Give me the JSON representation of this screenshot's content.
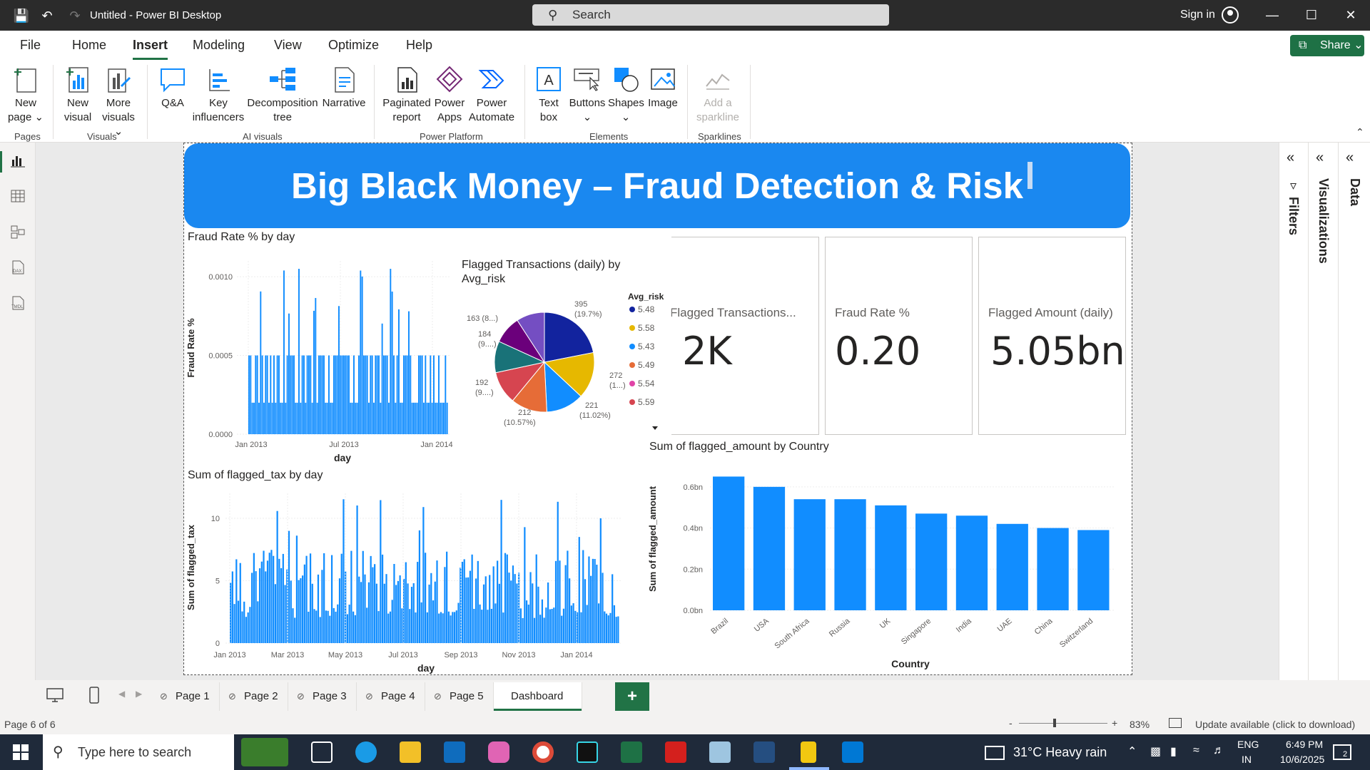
{
  "window": {
    "title": "Untitled - Power BI Desktop",
    "search_placeholder": "Search",
    "sign_in": "Sign in"
  },
  "menu": {
    "items": [
      "File",
      "Home",
      "Insert",
      "Modeling",
      "View",
      "Optimize",
      "Help"
    ],
    "active": "Insert",
    "share": "Share"
  },
  "ribbon": {
    "groups": {
      "pages": "Pages",
      "visuals": "Visuals",
      "ai_visuals": "AI visuals",
      "power_platform": "Power Platform",
      "elements": "Elements",
      "sparklines": "Sparklines"
    },
    "new_page": [
      "New",
      "page"
    ],
    "new_visual": [
      "New",
      "visual"
    ],
    "more_visuals": [
      "More",
      "visuals"
    ],
    "qa": "Q&A",
    "key_influencers": [
      "Key",
      "influencers"
    ],
    "decomposition_tree": [
      "Decomposition",
      "tree"
    ],
    "narrative": "Narrative",
    "paginated_report": [
      "Paginated",
      "report"
    ],
    "power_apps": [
      "Power",
      "Apps"
    ],
    "power_automate": [
      "Power",
      "Automate"
    ],
    "text_box": [
      "Text",
      "box"
    ],
    "buttons": "Buttons",
    "shapes": "Shapes",
    "image": "Image",
    "add_sparkline": [
      "Add a",
      "sparkline"
    ]
  },
  "report": {
    "banner_title": "Big Black Money – Fraud Detection & Risk",
    "cards": [
      {
        "label": "Flagged Transactions...",
        "value": "2K"
      },
      {
        "label": "Fraud Rate %",
        "value": "0.20"
      },
      {
        "label": "Flagged Amount (daily)",
        "value": "5.05bn"
      }
    ]
  },
  "chart_data": [
    {
      "type": "bar",
      "title": "Fraud Rate % by day",
      "xlabel": "day",
      "ylabel": "Fraud Rate %",
      "x_ticks": [
        "Jan 2013",
        "Jul 2013",
        "Jan 2014"
      ],
      "y_ticks": [
        "0.0000",
        "0.0005",
        "0.0010"
      ],
      "ylim": [
        0,
        0.0011
      ],
      "x_range": [
        "2013-01-01",
        "2014-02-28"
      ],
      "note_values": "daily series, ~0.0005 mostly with spikes up to 0.0011",
      "color": "#118dff"
    },
    {
      "type": "pie",
      "title": "Flagged Transactions (daily) by Avg_risk",
      "legend_title": "Avg_risk",
      "legend": [
        "5.48",
        "5.58",
        "5.43",
        "5.49",
        "5.54",
        "5.59"
      ],
      "slices": [
        {
          "value": 395,
          "label": "395",
          "sublabel": "(19.7%)",
          "color": "#12239e"
        },
        {
          "value": 272,
          "label": "272",
          "sublabel": "(1...)",
          "color": "#e6b800"
        },
        {
          "value": 221,
          "label": "221",
          "sublabel": "(11.02%)",
          "color": "#118dff"
        },
        {
          "value": 212,
          "label": "212",
          "sublabel": "(10.57%)",
          "color": "#e66c37"
        },
        {
          "value": 192,
          "label": "192",
          "sublabel": "(9....)",
          "color": "#d64550"
        },
        {
          "value": 184,
          "label": "184",
          "sublabel": "(9....)",
          "color": "#197278"
        },
        {
          "value": 163,
          "label": "163 (8...)",
          "sublabel": "",
          "color": "#6b007b"
        },
        {
          "value": 165,
          "label": "",
          "sublabel": "",
          "color": "#744ec2"
        }
      ],
      "legend_colors": [
        "#12239e",
        "#e6b800",
        "#118dff",
        "#e66c37",
        "#e044a7",
        "#d64550"
      ]
    },
    {
      "type": "bar",
      "title": "Sum of flagged_tax by day",
      "xlabel": "day",
      "ylabel": "Sum of flagged_tax",
      "x_ticks": [
        "Jan 2013",
        "Mar 2013",
        "May 2013",
        "Jul 2013",
        "Sep 2013",
        "Nov 2013",
        "Jan 2014"
      ],
      "y_ticks": [
        "0",
        "5",
        "10"
      ],
      "ylim": [
        0,
        12
      ],
      "color": "#118dff"
    },
    {
      "type": "bar",
      "title": "Sum of flagged_amount by Country",
      "xlabel": "Country",
      "ylabel": "Sum of flagged_amount",
      "categories": [
        "Brazil",
        "USA",
        "South Africa",
        "Russia",
        "UK",
        "Singapore",
        "India",
        "UAE",
        "China",
        "Switzerland"
      ],
      "values": [
        0.65,
        0.6,
        0.54,
        0.54,
        0.51,
        0.47,
        0.46,
        0.42,
        0.4,
        0.39
      ],
      "y_ticks": [
        "0.0bn",
        "0.2bn",
        "0.4bn",
        "0.6bn"
      ],
      "ylim": [
        0,
        0.7
      ],
      "color": "#118dff"
    }
  ],
  "panes": {
    "filters": "Filters",
    "visualizations": "Visualizations",
    "data": "Data"
  },
  "tabs": {
    "pages": [
      "Page 1",
      "Page 2",
      "Page 3",
      "Page 4",
      "Page 5",
      "Dashboard"
    ],
    "active": "Dashboard"
  },
  "status": {
    "page": "Page 6 of 6",
    "zoom": "83%",
    "update": "Update available (click to download)"
  },
  "taskbar": {
    "search_placeholder": "Type here to search",
    "weather": "31°C  Heavy rain",
    "lang1": "ENG",
    "lang2": "IN",
    "time": "6:49 PM",
    "date": "10/6/2025",
    "notifications": "2"
  }
}
